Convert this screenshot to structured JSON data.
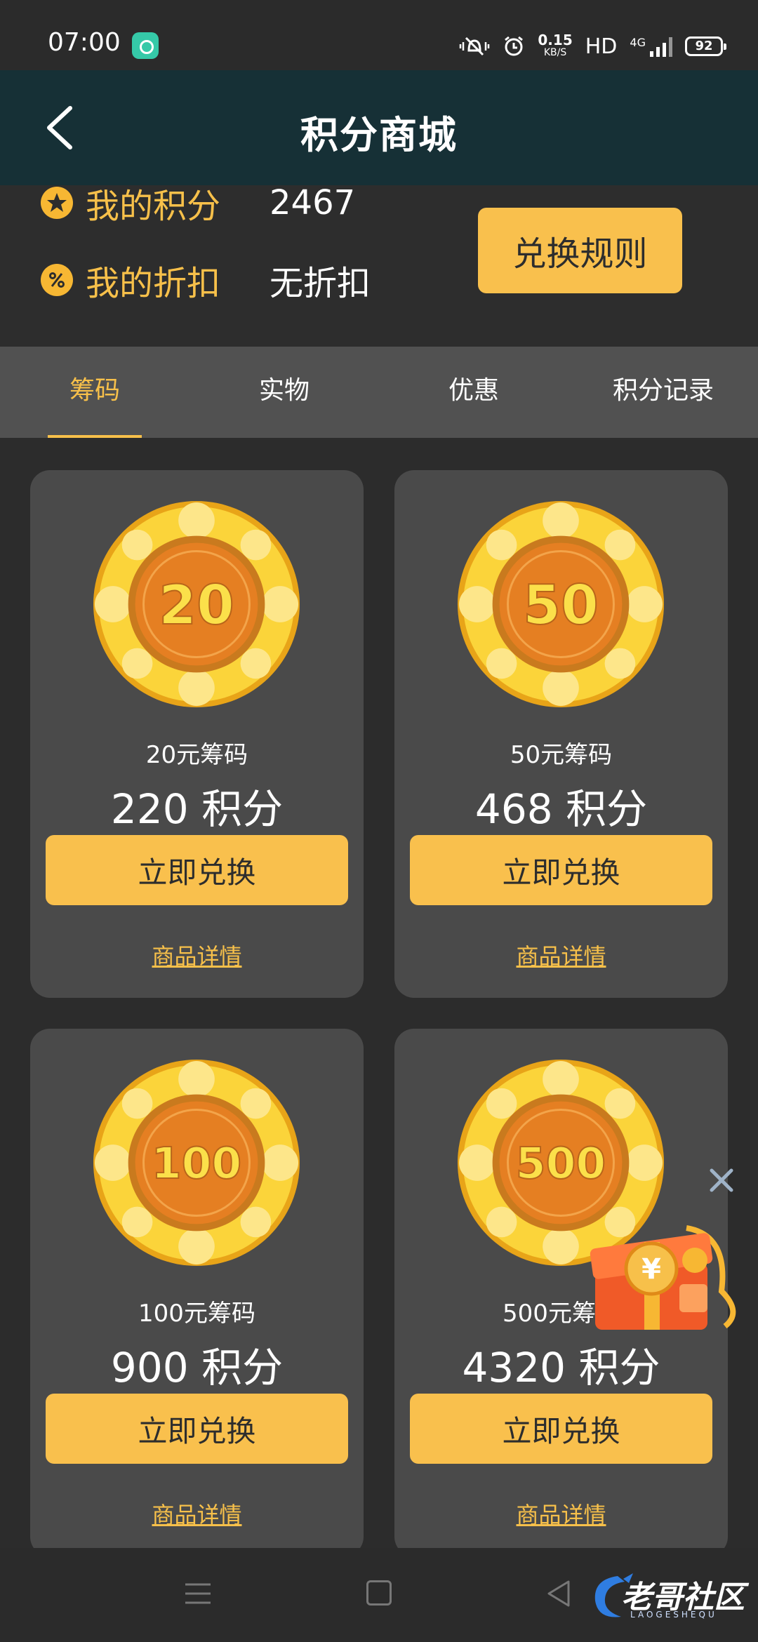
{
  "status_bar": {
    "time": "07:00",
    "speed_value": "0.15",
    "speed_unit": "KB/S",
    "hd": "HD",
    "network": "4G",
    "battery": "92"
  },
  "header": {
    "title": "积分商城",
    "back_icon": "back-arrow-icon"
  },
  "points": {
    "my_points_label": "我的积分",
    "my_points_value": "2467",
    "my_discount_label": "我的折扣",
    "my_discount_value": "无折扣",
    "rules_button": "兑换规则"
  },
  "tabs": [
    {
      "label": "筹码",
      "active": true
    },
    {
      "label": "实物",
      "active": false
    },
    {
      "label": "优惠",
      "active": false
    },
    {
      "label": "积分记录",
      "active": false
    }
  ],
  "products": [
    {
      "chip_value": "20",
      "name": "20元筹码",
      "price": "220 积分",
      "button": "立即兑换",
      "detail": "商品详情"
    },
    {
      "chip_value": "50",
      "name": "50元筹码",
      "price": "468 积分",
      "button": "立即兑换",
      "detail": "商品详情"
    },
    {
      "chip_value": "100",
      "name": "100元筹码",
      "price": "900 积分",
      "button": "立即兑换",
      "detail": "商品详情"
    },
    {
      "chip_value": "500",
      "name": "500元筹码",
      "price": "4320 积分",
      "button": "立即兑换",
      "detail": "商品详情"
    }
  ],
  "floating_gift": {
    "icon": "gift-box-icon",
    "close_icon": "close-icon"
  },
  "watermark": {
    "text": "老哥社区",
    "subtext": "LAOGESHEQU"
  },
  "colors": {
    "accent": "#f9c04d",
    "header_bg": "#163036",
    "card_bg": "#4a4a4a",
    "tab_bg": "#515151"
  }
}
